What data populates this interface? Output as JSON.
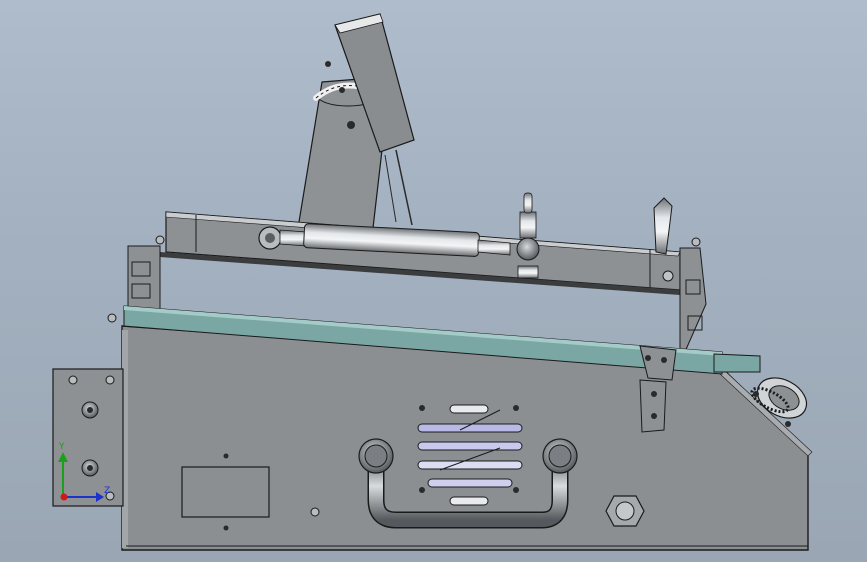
{
  "viewport": {
    "background_top": "#aebccc",
    "background_bottom": "#9aa6b3"
  },
  "model": {
    "body_color": "#8c8f92",
    "edge_color": "#1a1a1a",
    "rail_color": "#7aa6a3",
    "chrome_color": "#c8ccd0"
  },
  "triad": {
    "y_label": "Y",
    "z_label": "Z",
    "y_color": "#1aa01a",
    "z_color": "#1a33cc",
    "x_color": "#cc1a1a"
  }
}
